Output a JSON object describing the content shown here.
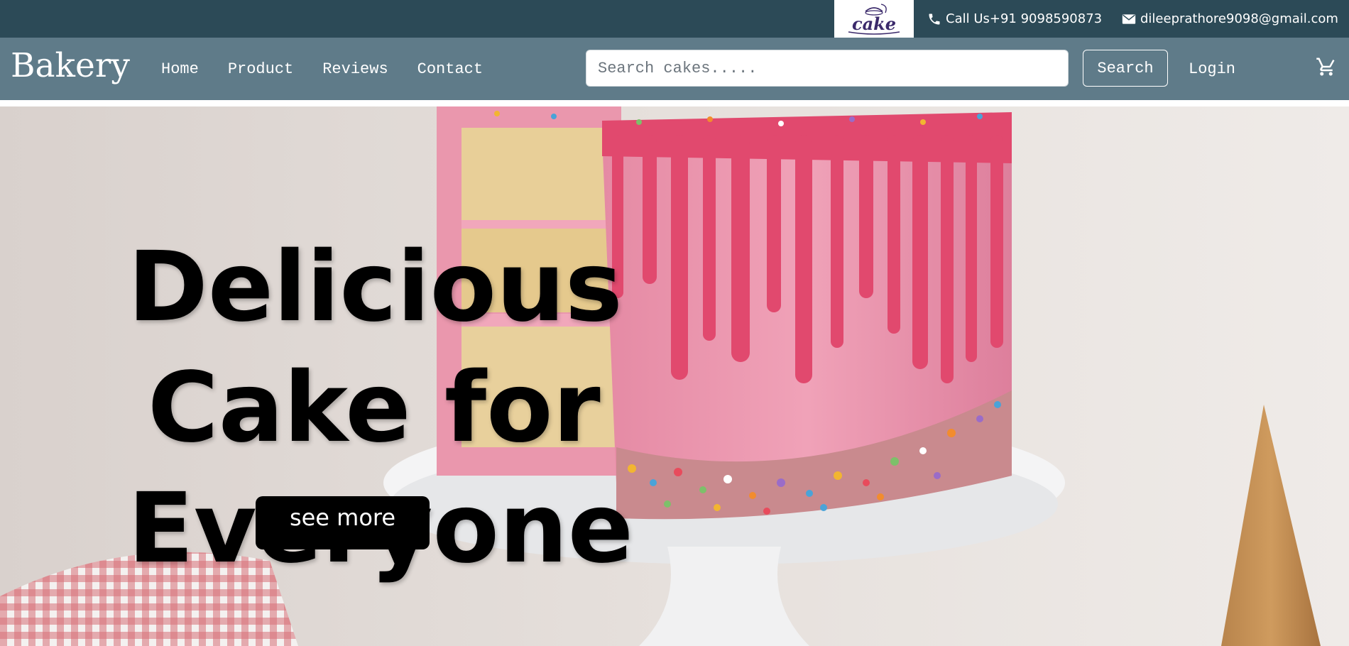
{
  "topbar": {
    "logo_text": "cake",
    "phone": "Call Us+91 9098590873",
    "email": "dileeprathore9098@gmail.com"
  },
  "navbar": {
    "brand": "Bakery",
    "links": [
      "Home",
      "Product",
      "Reviews",
      "Contact"
    ],
    "search_placeholder": "Search cakes.....",
    "search_button": "Search",
    "login": "Login"
  },
  "hero": {
    "headline_lines": [
      "Delicious",
      "Cake for",
      "Everyone"
    ],
    "cta": "see more"
  },
  "colors": {
    "topbar_bg": "#2c4a57",
    "navbar_bg": "#5f7b89",
    "cake_pink": "#e88fa8",
    "drip_red": "#e1496e",
    "cta_bg": "#000000"
  }
}
